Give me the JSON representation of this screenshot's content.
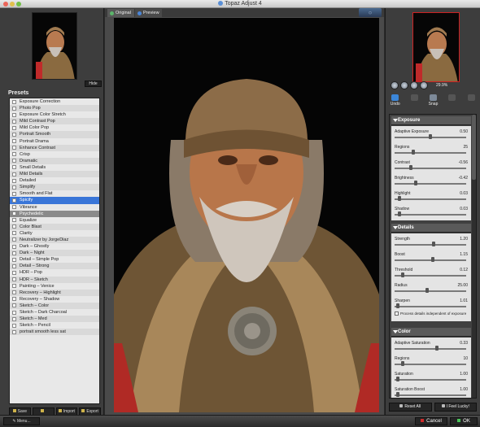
{
  "window": {
    "title": "Topaz Adjust 4"
  },
  "navigator": {
    "hide_label": "Hide"
  },
  "presets": {
    "title": "Presets",
    "selected": "Spicify",
    "items": [
      "Exposure Correction",
      "Photo Pop",
      "Exposure Color Stretch",
      "Mild Contrast Pop",
      "Mild Color Pop",
      "Portrait Smooth",
      "Portrait Drama",
      "Enhance Contrast",
      "Crisp",
      "Dramatic",
      "Small Details",
      "Mild Details",
      "Detailed",
      "Simplify",
      "Smooth and Flat",
      "Spicify",
      "Vibrance",
      "Psychedelic",
      "Equalize",
      "Color Blast",
      "Clarity",
      "Neutralizer by JorgeDiaz",
      "Dark – Ghostly",
      "Dark – Night",
      "Detail – Simple Pop",
      "Detail – Strong",
      "HDR – Pop",
      "HDR – Sketch",
      "Painting – Venice",
      "Recovery – Highlight",
      "Recovery – Shadow",
      "Sketch – Color",
      "Sketch – Dark Charcoal",
      "Sketch – Med",
      "Sketch – Pencil",
      "portrait smooth less sat"
    ],
    "buttons": {
      "save": "Save",
      "import": "Import",
      "export": "Export"
    }
  },
  "tabs": {
    "original": "Original",
    "preview": "Preview"
  },
  "zoom": {
    "value": "29.9%"
  },
  "tools": {
    "undo": "Undo",
    "snap": "Snap"
  },
  "exposure": {
    "title": "Exposure",
    "sliders": [
      {
        "label": "Adaptive Exposure",
        "value": "0.50",
        "pos": 0.5
      },
      {
        "label": "Regions",
        "value": "25",
        "pos": 0.25
      },
      {
        "label": "Contrast",
        "value": "-0.56",
        "pos": 0.22
      },
      {
        "label": "Brightness",
        "value": "-0.42",
        "pos": 0.29
      },
      {
        "label": "Highlight",
        "value": "0.03",
        "pos": 0.05
      },
      {
        "label": "Shadow",
        "value": "0.03",
        "pos": 0.05
      }
    ]
  },
  "details": {
    "title": "Details",
    "sliders": [
      {
        "label": "Strength",
        "value": "1.20",
        "pos": 0.55
      },
      {
        "label": "Boost",
        "value": "1.15",
        "pos": 0.53
      },
      {
        "label": "Threshold",
        "value": "0.12",
        "pos": 0.1
      },
      {
        "label": "Radius",
        "value": "25.00",
        "pos": 0.45
      },
      {
        "label": "Sharpen",
        "value": "1.01",
        "pos": 0.02
      }
    ],
    "checkbox_label": "Process details independent of exposure"
  },
  "color": {
    "title": "Color",
    "sliders": [
      {
        "label": "Adaptive Saturation",
        "value": "0.33",
        "pos": 0.6
      },
      {
        "label": "Regions",
        "value": "10",
        "pos": 0.1
      },
      {
        "label": "Saturation",
        "value": "1.00",
        "pos": 0.02
      },
      {
        "label": "Saturation Boost",
        "value": "1.00",
        "pos": 0.02
      }
    ]
  },
  "panel_buttons": {
    "reset_all": "Reset All",
    "feel_lucky": "I Feel Lucky!"
  },
  "bottom": {
    "menu": "Menu...",
    "cancel": "Cancel",
    "ok": "OK"
  }
}
